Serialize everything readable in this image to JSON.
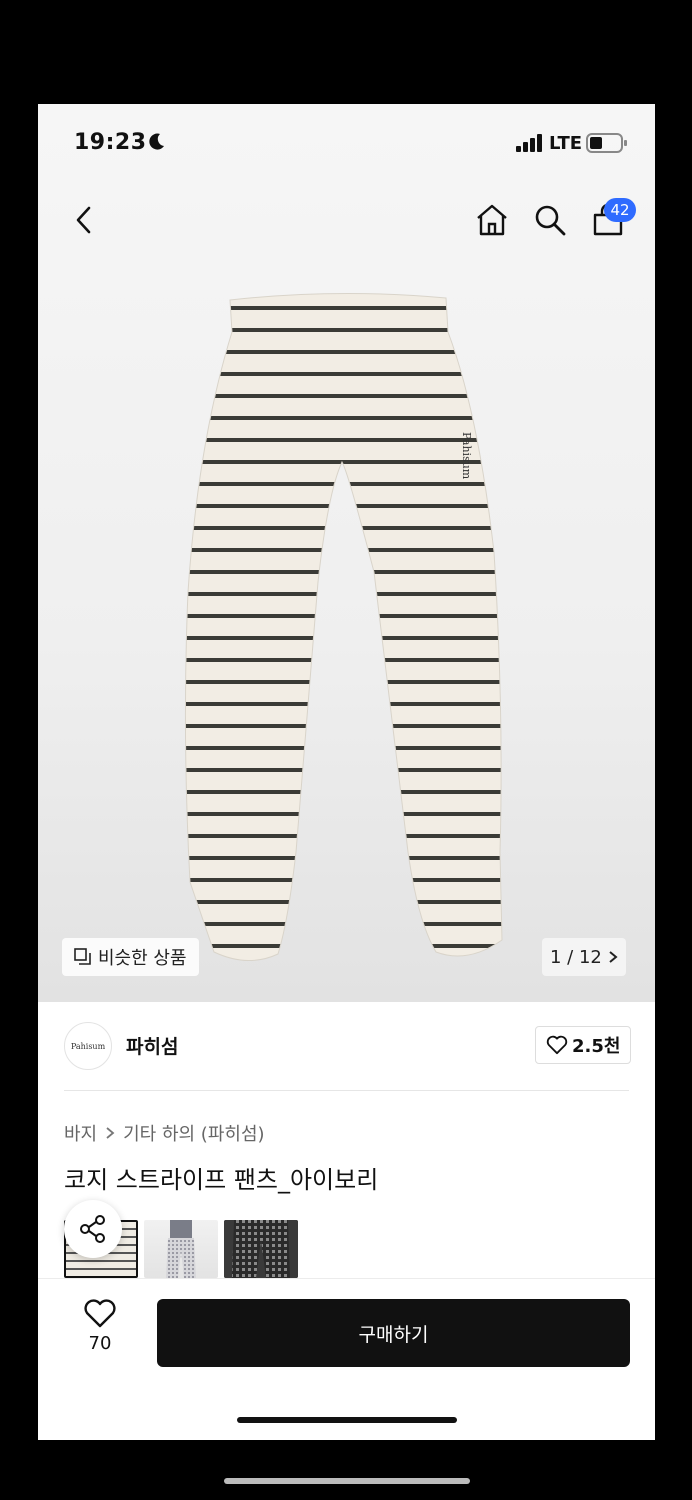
{
  "status_bar": {
    "time": "19:23",
    "network": "LTE",
    "icons": [
      "moon-icon",
      "signal-icon",
      "battery-icon"
    ]
  },
  "nav": {
    "icons": [
      "back-icon",
      "home-icon",
      "search-icon",
      "cart-icon"
    ],
    "cart_badge": "42",
    "badge_color": "#2f6bff"
  },
  "hero": {
    "similar_label": "비슷한 상품",
    "counter": "1 / 12",
    "pants_logo_text": "Pahisum"
  },
  "brand": {
    "logo_text": "Pahisum",
    "name": "파히섬",
    "likes": "2.5천"
  },
  "breadcrumb": {
    "category": "바지",
    "sub_category": "기타 하의 (파히섬)"
  },
  "product": {
    "title": "코지 스트라이프 팬츠_아이보리"
  },
  "bottom_bar": {
    "wish_count": "70",
    "buy_label": "구매하기"
  }
}
